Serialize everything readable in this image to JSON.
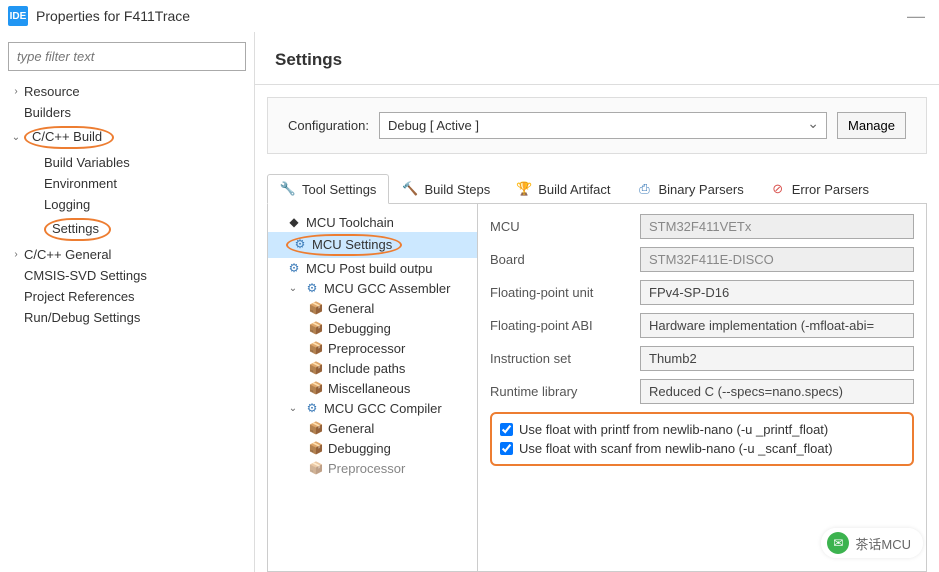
{
  "window": {
    "title": "Properties for F411Trace",
    "logo": "IDE"
  },
  "filter": {
    "placeholder": "type filter text"
  },
  "nav": {
    "resource": "Resource",
    "builders": "Builders",
    "ccpp_build": "C/C++ Build",
    "build_vars": "Build Variables",
    "environment": "Environment",
    "logging": "Logging",
    "settings": "Settings",
    "ccpp_general": "C/C++ General",
    "cmsis": "CMSIS-SVD Settings",
    "proj_refs": "Project References",
    "run_debug": "Run/Debug Settings"
  },
  "header": {
    "title": "Settings"
  },
  "config": {
    "label": "Configuration:",
    "value": "Debug  [ Active ]",
    "manage": "Manage"
  },
  "tabs": {
    "tool_settings": "Tool Settings",
    "build_steps": "Build Steps",
    "build_artifact": "Build Artifact",
    "binary_parsers": "Binary Parsers",
    "error_parsers": "Error Parsers"
  },
  "tool_tree": {
    "mcu_toolchain": "MCU Toolchain",
    "mcu_settings": "MCU Settings",
    "mcu_post": "MCU Post build outpu",
    "gcc_asm": "MCU GCC Assembler",
    "general": "General",
    "debugging": "Debugging",
    "preprocessor": "Preprocessor",
    "include_paths": "Include paths",
    "misc": "Miscellaneous",
    "gcc_comp": "MCU GCC Compiler",
    "general2": "General",
    "debugging2": "Debugging",
    "preprocessor2": "Preprocessor"
  },
  "form": {
    "mcu_label": "MCU",
    "mcu_val": "STM32F411VETx",
    "board_label": "Board",
    "board_val": "STM32F411E-DISCO",
    "fpu_label": "Floating-point unit",
    "fpu_val": "FPv4-SP-D16",
    "fabi_label": "Floating-point ABI",
    "fabi_val": "Hardware implementation (-mfloat-abi=",
    "inst_label": "Instruction set",
    "inst_val": "Thumb2",
    "runtime_label": "Runtime library",
    "runtime_val": "Reduced C (--specs=nano.specs)",
    "chk_printf": "Use float with printf from newlib-nano (-u _printf_float)",
    "chk_scanf": "Use float with scanf from newlib-nano (-u _scanf_float)"
  },
  "watermark": "茶话MCU"
}
